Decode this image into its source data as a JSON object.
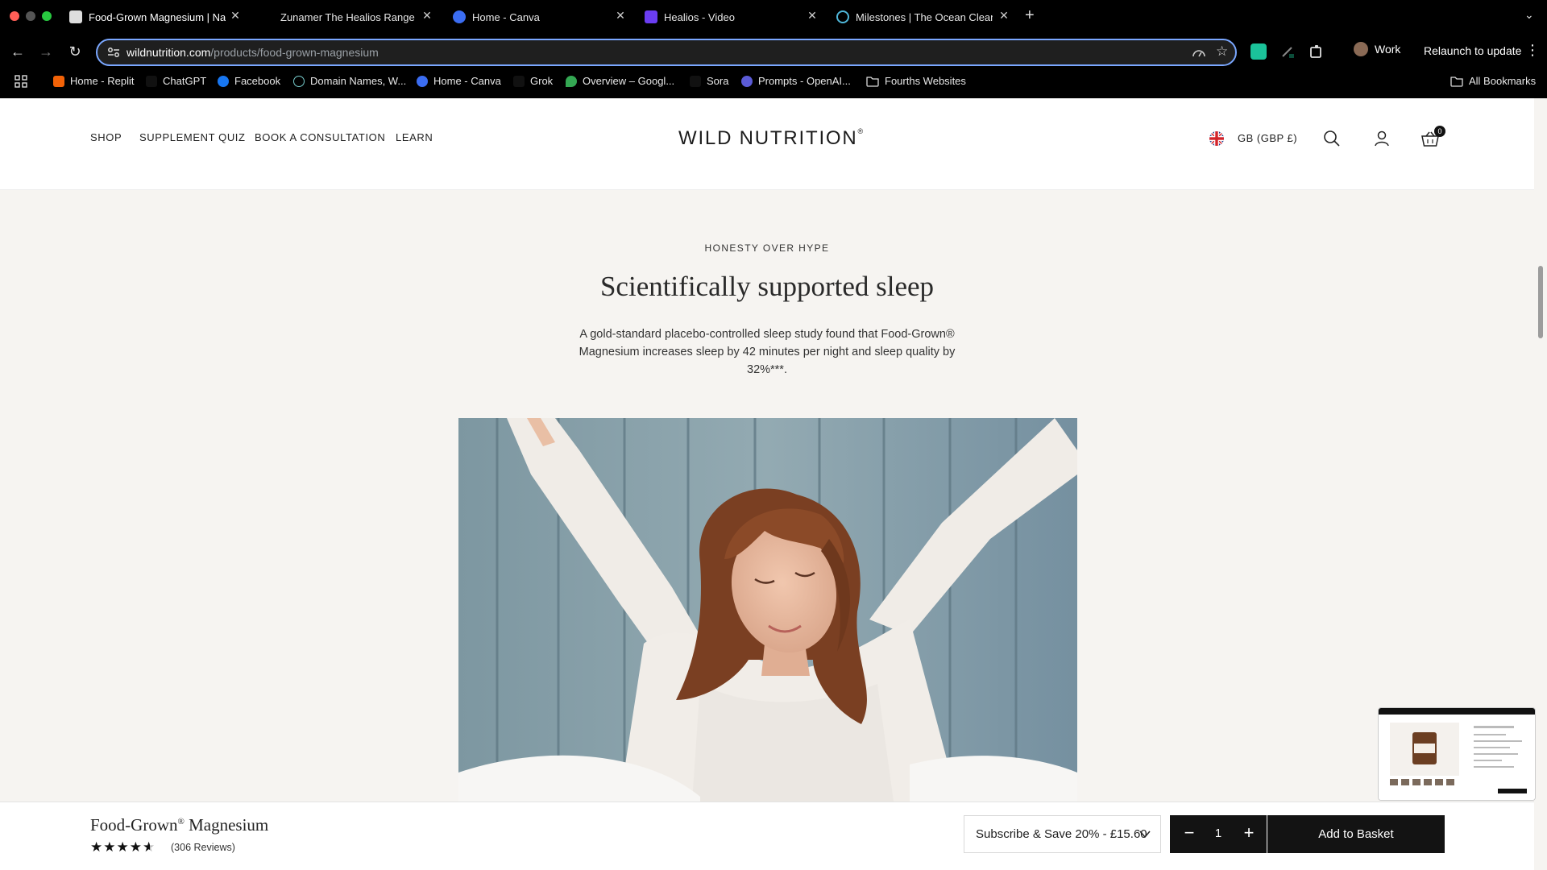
{
  "browser": {
    "tabs": [
      {
        "title": "Food-Grown Magnesium | Na",
        "active": true
      },
      {
        "title": "Zunamer The Healios Range"
      },
      {
        "title": "Home - Canva"
      },
      {
        "title": "Healios - Video"
      },
      {
        "title": "Milestones | The Ocean Clean"
      }
    ],
    "url_domain": "wildnutrition.com",
    "url_path": "/products/food-grown-magnesium",
    "profile_label": "Work",
    "relaunch_label": "Relaunch to update",
    "bookmarks": [
      "Home - Replit",
      "ChatGPT",
      "Facebook",
      "Domain Names, W...",
      "Home - Canva",
      "Grok",
      "Overview – Googl...",
      "Sora",
      "Prompts - OpenAI...",
      "Fourths Websites"
    ],
    "all_bookmarks_label": "All Bookmarks"
  },
  "site": {
    "nav": [
      "SHOP",
      "SUPPLEMENT QUIZ",
      "BOOK A CONSULTATION",
      "LEARN"
    ],
    "logo": "WILD NUTRITION",
    "logo_mark": "®",
    "currency": "GB (GBP £)",
    "cart_count": "0"
  },
  "section": {
    "eyebrow": "HONESTY OVER HYPE",
    "headline": "Scientifically supported sleep",
    "body": "A gold-standard placebo-controlled sleep study found that Food-Grown® Magnesium increases sleep by 42 minutes per night and sleep quality by 32%***."
  },
  "sticky": {
    "product_name": "Food-Grown",
    "product_mark": "®",
    "product_name_rest": " Magnesium",
    "rating": 4.5,
    "reviews_label": "(306 Reviews)",
    "subscription_option": "Subscribe & Save 20% - £15.60",
    "quantity": "1",
    "add_label": "Add to Basket"
  },
  "colors": {
    "page_bg": "#f6f4f1",
    "button_dark": "#131313",
    "focus_ring": "#7aa7ff"
  }
}
